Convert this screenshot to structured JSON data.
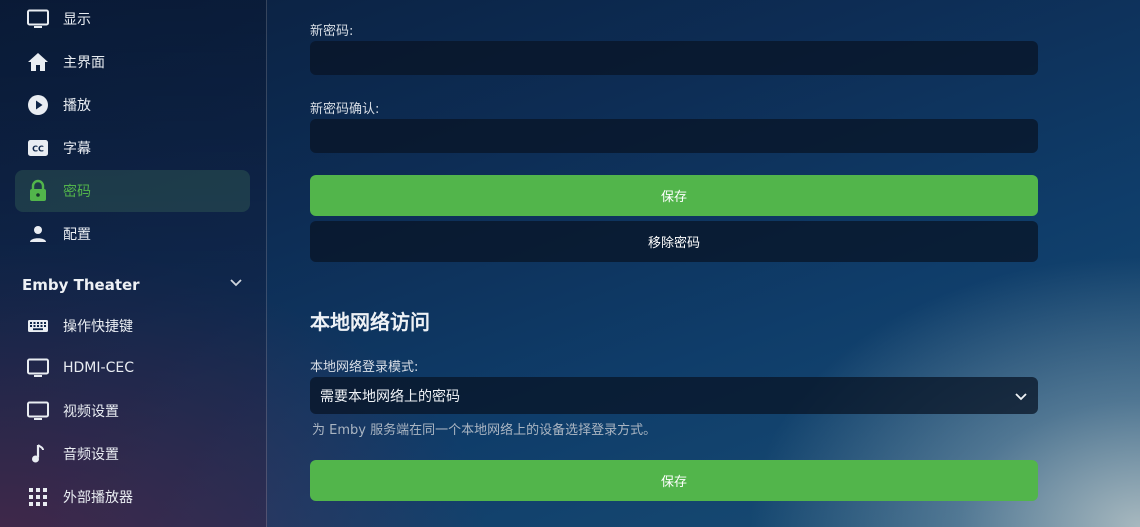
{
  "sidebar": {
    "items": [
      {
        "label": "显示",
        "icon": "monitor-icon"
      },
      {
        "label": "主界面",
        "icon": "home-icon"
      },
      {
        "label": "播放",
        "icon": "play-circle-icon"
      },
      {
        "label": "字幕",
        "icon": "closed-caption-icon"
      },
      {
        "label": "密码",
        "icon": "lock-icon",
        "active": true
      },
      {
        "label": "配置",
        "icon": "person-icon"
      }
    ],
    "section_title": "Emby Theater",
    "section_items": [
      {
        "label": "操作快捷键",
        "icon": "keyboard-icon"
      },
      {
        "label": "HDMI-CEC",
        "icon": "monitor-icon"
      },
      {
        "label": "视频设置",
        "icon": "monitor-icon"
      },
      {
        "label": "音频设置",
        "icon": "music-note-icon"
      },
      {
        "label": "外部播放器",
        "icon": "grid-icon"
      }
    ]
  },
  "main": {
    "new_password_label": "新密码:",
    "new_password_value": "",
    "confirm_password_label": "新密码确认:",
    "confirm_password_value": "",
    "save_label": "保存",
    "remove_password_label": "移除密码",
    "local_network_heading": "本地网络访问",
    "local_login_mode_label": "本地网络登录模式:",
    "local_login_mode_value": "需要本地网络上的密码",
    "local_login_mode_help": "为 Emby 服务端在同一个本地网络上的设备选择登录方式。",
    "save_label_2": "保存"
  },
  "colors": {
    "accent": "#52b54b",
    "input_bg": "#0a1a30"
  }
}
